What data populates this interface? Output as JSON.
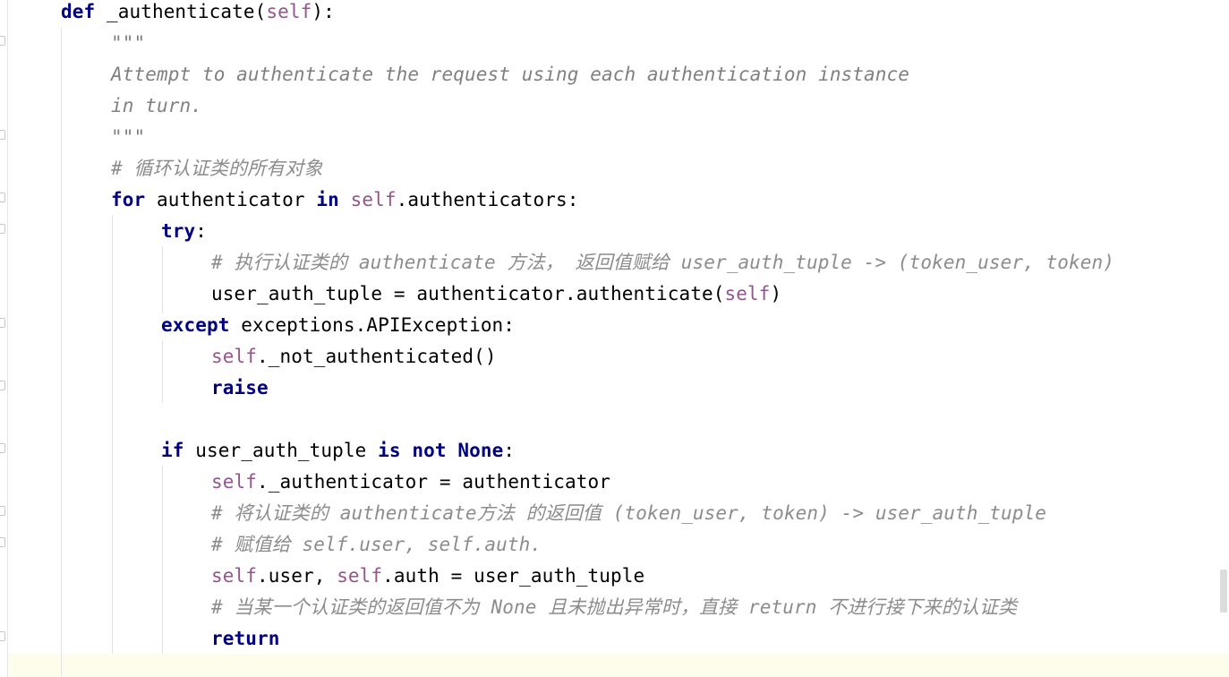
{
  "editor": {
    "lines": [
      [
        {
          "t": "def",
          "c": "kw"
        },
        {
          "t": " _authenticate("
        },
        {
          "t": "self",
          "c": "self"
        },
        {
          "t": "):"
        }
      ],
      [
        {
          "t": "\"\"\"",
          "c": "doc"
        }
      ],
      [
        {
          "t": "Attempt to authenticate the request using each authentication instance",
          "c": "doc"
        }
      ],
      [
        {
          "t": "in turn.",
          "c": "doc"
        }
      ],
      [
        {
          "t": "\"\"\"",
          "c": "doc"
        }
      ],
      [
        {
          "t": "# 循环认证类的所有对象",
          "c": "cmt"
        }
      ],
      [
        {
          "t": "for",
          "c": "kw"
        },
        {
          "t": " authenticator "
        },
        {
          "t": "in",
          "c": "kw"
        },
        {
          "t": " "
        },
        {
          "t": "self",
          "c": "self"
        },
        {
          "t": ".authenticators:"
        }
      ],
      [
        {
          "t": "try",
          "c": "kw"
        },
        {
          "t": ":"
        }
      ],
      [
        {
          "t": "# 执行认证类的 authenticate 方法， 返回值赋给 user_auth_tuple -> (token_user, token)",
          "c": "cmt"
        }
      ],
      [
        {
          "t": "user_auth_tuple = authenticator.authenticate("
        },
        {
          "t": "self",
          "c": "self"
        },
        {
          "t": ")"
        }
      ],
      [
        {
          "t": "except",
          "c": "kw"
        },
        {
          "t": " exceptions.APIException:"
        }
      ],
      [
        {
          "t": "self",
          "c": "self"
        },
        {
          "t": "._not_authenticated()"
        }
      ],
      [
        {
          "t": "raise",
          "c": "kw"
        }
      ],
      [],
      [
        {
          "t": "if",
          "c": "kw"
        },
        {
          "t": " user_auth_tuple "
        },
        {
          "t": "is",
          "c": "kw"
        },
        {
          "t": " "
        },
        {
          "t": "not",
          "c": "kw"
        },
        {
          "t": " "
        },
        {
          "t": "None",
          "c": "kw"
        },
        {
          "t": ":"
        }
      ],
      [
        {
          "t": "self",
          "c": "self"
        },
        {
          "t": "._authenticator = authenticator"
        }
      ],
      [
        {
          "t": "# 将认证类的 authenticate方法 的返回值 (token_user, token) -> user_auth_tuple",
          "c": "cmt"
        }
      ],
      [
        {
          "t": "# 赋值给 self.user, self.auth.",
          "c": "cmt"
        }
      ],
      [
        {
          "t": "self",
          "c": "self"
        },
        {
          "t": ".user, "
        },
        {
          "t": "self",
          "c": "self"
        },
        {
          "t": ".auth = user_auth_tuple"
        }
      ],
      [
        {
          "t": "# 当某一个认证类的返回值不为 None 且未抛出异常时，直接 return 不进行接下来的认证类",
          "c": "cmt"
        }
      ],
      [
        {
          "t": "return",
          "c": "kw"
        }
      ]
    ]
  }
}
